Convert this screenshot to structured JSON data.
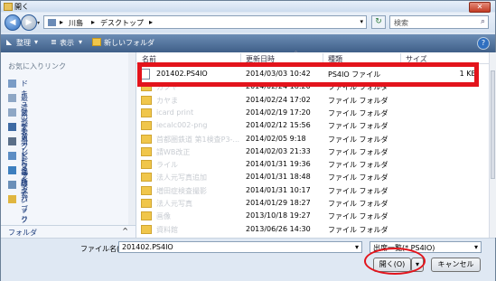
{
  "window": {
    "title": "開く",
    "close_glyph": "✕"
  },
  "nav": {
    "back_glyph": "◀",
    "forward_glyph": "▶",
    "dropdown_glyph": "▾",
    "breadcrumb": [
      "川島",
      "デスクトップ"
    ],
    "separator": "▸",
    "refresh_glyph": "↻",
    "search_placeholder": "検索",
    "search_icon": "⌕"
  },
  "toolbar": {
    "organize": "整理",
    "view": "表示",
    "new_folder": "新しいフォルダ",
    "help": "?"
  },
  "sidebar": {
    "section_title": "お気に入りリンク",
    "items": [
      {
        "label": "ドキュメント",
        "icon": "documents-icon",
        "color": "#7a9cc6"
      },
      {
        "label": "最近の変更",
        "icon": "recent-changes-icon",
        "color": "#8ea7c5"
      },
      {
        "label": "最近表示した場所",
        "icon": "recent-places-icon",
        "color": "#8ea7c5"
      },
      {
        "label": "デスクトップ",
        "icon": "desktop-icon",
        "color": "#3e6aa3"
      },
      {
        "label": "コンピュータ",
        "icon": "computer-icon",
        "color": "#5b6f88"
      },
      {
        "label": "ピクチャ",
        "icon": "pictures-icon",
        "color": "#5c8dc4"
      },
      {
        "label": "ミュージック",
        "icon": "music-icon",
        "color": "#3d7fbf"
      },
      {
        "label": "検索",
        "icon": "search-folder-icon",
        "color": "#6a8fb8"
      },
      {
        "label": "パブリック",
        "icon": "public-folder-icon",
        "color": "#e0b640"
      }
    ],
    "folders_label": "フォルダ",
    "folders_chevron": "^"
  },
  "columns": {
    "name": "名前",
    "date": "更新日時",
    "type": "種類",
    "size": "サイズ",
    "sort_glyph": "^"
  },
  "files": [
    {
      "name": "201402.PS4IO",
      "date": "2014/03/03 10:42",
      "type": "PS4IO ファイル",
      "size": "1 KB",
      "kind": "doc",
      "faded": false
    },
    {
      "name": "カクヤ",
      "date": "2014/02/24 18:20",
      "type": "ファイル フォルダ",
      "size": "",
      "kind": "folder",
      "faded": true
    },
    {
      "name": "カヤま",
      "date": "2014/02/24 17:02",
      "type": "ファイル フォルダ",
      "size": "",
      "kind": "folder",
      "faded": true
    },
    {
      "name": "icard print",
      "date": "2014/02/19 17:20",
      "type": "ファイル フォルダ",
      "size": "",
      "kind": "folder",
      "faded": true
    },
    {
      "name": "iecalc002-png",
      "date": "2014/02/12 15:56",
      "type": "ファイル フォルダ",
      "size": "",
      "kind": "folder",
      "faded": true
    },
    {
      "name": "首都圏鉄道 第1検査P3-...",
      "date": "2014/02/05 9:18",
      "type": "ファイル フォルダ",
      "size": "",
      "kind": "folder",
      "faded": true
    },
    {
      "name": "請WB改正",
      "date": "2014/02/03 21:33",
      "type": "ファイル フォルダ",
      "size": "",
      "kind": "folder",
      "faded": true
    },
    {
      "name": "ライル",
      "date": "2014/01/31 19:36",
      "type": "ファイル フォルダ",
      "size": "",
      "kind": "folder",
      "faded": true
    },
    {
      "name": "法人元写真追加",
      "date": "2014/01/31 18:48",
      "type": "ファイル フォルダ",
      "size": "",
      "kind": "folder",
      "faded": true
    },
    {
      "name": "増田症検査撮影",
      "date": "2014/01/31 10:17",
      "type": "ファイル フォルダ",
      "size": "",
      "kind": "folder",
      "faded": true
    },
    {
      "name": "法人元写真",
      "date": "2014/01/29 18:27",
      "type": "ファイル フォルダ",
      "size": "",
      "kind": "folder",
      "faded": true
    },
    {
      "name": "画像",
      "date": "2013/10/18 19:27",
      "type": "ファイル フォルダ",
      "size": "",
      "kind": "folder",
      "faded": true
    },
    {
      "name": "資料館",
      "date": "2013/06/26 14:30",
      "type": "ファイル フォルダ",
      "size": "",
      "kind": "folder",
      "faded": true
    }
  ],
  "bottom": {
    "filename_label": "ファイル名(N):",
    "filename_value": "201402.PS4IO",
    "filetype_value": "出席一覧(*.PS4IO)",
    "open_label": "開く(O)",
    "cancel_label": "キャンセル",
    "dropdown_glyph": "▾"
  },
  "colors": {
    "annotation_red": "#e3141c",
    "toolbar_blue": "#4f6f98"
  }
}
